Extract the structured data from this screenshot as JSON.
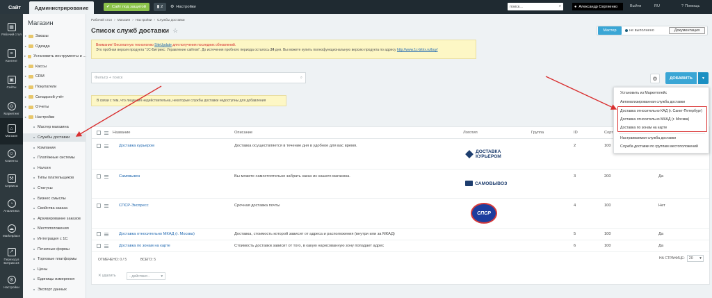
{
  "topbar": {
    "site_tab": "Сайт",
    "admin_tab": "Администрирование",
    "protect_label": "Сайт под защитой",
    "notif_count": "2",
    "settings_label": "Настройки",
    "search_value": "поиск...",
    "user_name": "Александр Сергиенко",
    "exit_label": "Выйти",
    "lang_label": "RU",
    "help_label": "Помощь"
  },
  "leftbar": {
    "items": [
      {
        "label": "Рабочий стол",
        "icon": "desktop-icon"
      },
      {
        "label": "Контент",
        "icon": "content-icon"
      },
      {
        "label": "Сайты",
        "icon": "sites-icon"
      },
      {
        "label": "Маркетинг",
        "icon": "marketing-icon"
      },
      {
        "label": "Магазин",
        "icon": "shop-icon"
      },
      {
        "label": "Клиенты",
        "icon": "clients-icon"
      },
      {
        "label": "Сервисы",
        "icon": "services-icon"
      },
      {
        "label": "Аналитика",
        "icon": "analytics-icon"
      },
      {
        "label": "Marketplace",
        "icon": "marketplace-icon"
      },
      {
        "label": "Переход в Битрикс24",
        "icon": "bitrix24-icon"
      },
      {
        "label": "Настройки",
        "icon": "settings-icon"
      }
    ]
  },
  "menu": {
    "title": "Магазин",
    "items": [
      {
        "label": "Заказы",
        "level": 0
      },
      {
        "label": "Одежда",
        "level": 0
      },
      {
        "label": "Установить инструменты и ...",
        "level": 0
      },
      {
        "label": "Кассы",
        "level": 0
      },
      {
        "label": "CRM",
        "level": 0
      },
      {
        "label": "Покупатели",
        "level": 0
      },
      {
        "label": "Складской учёт",
        "level": 0
      },
      {
        "label": "Отчеты",
        "level": 0
      },
      {
        "label": "Настройки",
        "level": 0
      },
      {
        "label": "Мастер магазина",
        "level": 1
      },
      {
        "label": "Службы доставки",
        "level": 1
      },
      {
        "label": "Компании",
        "level": 1
      },
      {
        "label": "Платёжные системы",
        "level": 1
      },
      {
        "label": "Налоги",
        "level": 1
      },
      {
        "label": "Типы плательщиков",
        "level": 1
      },
      {
        "label": "Статусы",
        "level": 1
      },
      {
        "label": "Бизнес смыслы",
        "level": 1
      },
      {
        "label": "Свойства заказа",
        "level": 1
      },
      {
        "label": "Архивирование заказов",
        "level": 1
      },
      {
        "label": "Местоположения",
        "level": 1
      },
      {
        "label": "Интеграция с 1С",
        "level": 1
      },
      {
        "label": "Печатные формы",
        "level": 1
      },
      {
        "label": "Торговые платформы",
        "level": 1
      },
      {
        "label": "Цены",
        "level": 1
      },
      {
        "label": "Единицы измерения",
        "level": 1
      },
      {
        "label": "Экспорт данных",
        "level": 1
      }
    ]
  },
  "breadcrumb": [
    "Рабочий стол",
    "Магазин",
    "Настройки",
    "Службы доставки"
  ],
  "page_title": "Список служб доставки",
  "master": {
    "button": "Мастер",
    "status": "не выполнено",
    "doc_button": "Документация"
  },
  "warning": {
    "line1_pre": "Внимание! Бесплатную технологию",
    "line1_link": "SiteUpdate",
    "line1_post": "для получения последних обновлений.",
    "line2_pre": "Это пробная версия продукта \"1С-Битрикс: Управление сайтом\". До истечения пробного периода осталось",
    "line2_days": "24",
    "line2_post": "дня. Вы можете купить полнофункциональную версию продукта по адресу",
    "line2_link": "http://www.1c-bitrix.ru/buy/"
  },
  "filter": {
    "placeholder": "Фильтр + поиск"
  },
  "add_button": "ДОБАВИТЬ",
  "notice": "В связи с тем, что лицензия недействительна, некоторые службы доставки недоступны для добавления",
  "table": {
    "headers": {
      "name": "Название",
      "description": "Описание",
      "logo": "Логотип",
      "group": "Группа",
      "id": "ID",
      "sort": "Сорт"
    },
    "rows": [
      {
        "name": "Доставка курьером",
        "description": "Доставка осуществляется в течение дня в удобное для вас время.",
        "logo": "ДОСТАВКА КУРЬЕРОМ",
        "id": "2",
        "sort": "100",
        "active": ""
      },
      {
        "name": "Самовывоз",
        "description": "Вы можете самостоятельно забрать заказ из нашего магазина.",
        "logo": "САМОВЫВОЗ",
        "id": "3",
        "sort": "200",
        "active": "Да"
      },
      {
        "name": "СПСР-Экспресс",
        "description": "Срочная доставка почты",
        "logo": "СПСР",
        "id": "4",
        "sort": "100",
        "active": "Нет"
      },
      {
        "name": "Доставка относительно МКАД (г. Москва)",
        "description": "Доставка, стоимость которой зависит от адреса и расположения (внутри или за МКАД)",
        "logo": "",
        "id": "5",
        "sort": "100",
        "active": "Да"
      },
      {
        "name": "Доставка по зонам на карте",
        "description": "Стоимость доставки зависит от того, в какую нарисованную зону попадает адрес",
        "logo": "",
        "id": "6",
        "sort": "100",
        "active": "Да"
      }
    ]
  },
  "footer": {
    "selected": "ОТМЕЧЕНО: 0 / 5",
    "total": "ВСЕГО: 5",
    "per_page_label": "НА СТРАНИЦЕ:",
    "per_page": "20"
  },
  "actions": {
    "delete": "удалить",
    "select": "- действия -"
  },
  "dropdown": {
    "items": [
      "Установить из Маркетплейс",
      "Автоматизированная служба доставки",
      "Доставка относительно КАД (г. Санкт-Петербург)",
      "Доставка относительно МКАД (г. Москва)",
      "Доставка по зонам на карте",
      "Настраиваемая служба доставки",
      "Служба доставки по группам местоположений"
    ]
  },
  "colors": {
    "accent": "#3aa6d5",
    "annotation": "#d93030",
    "topbar": "#1f2a31"
  }
}
